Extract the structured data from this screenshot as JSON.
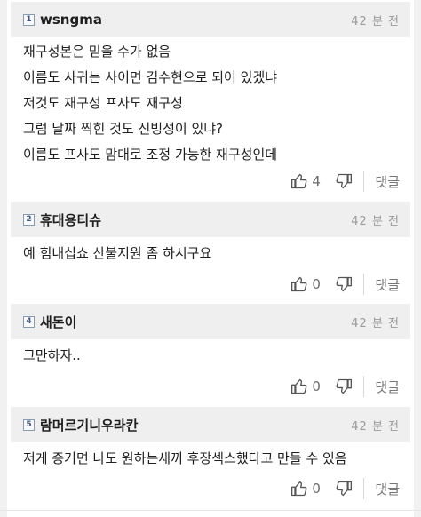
{
  "comments": [
    {
      "level": "1",
      "nickname": "wsngma",
      "time": "42 분 전",
      "lines": [
        "재구성본은 믿을 수가 없음",
        "이름도 사귀는 사이면 김수현으로 되어 있겠냐",
        "저것도 재구성 프사도 재구성",
        "그럼 날짜 찍힌 것도 신빙성이 있냐?",
        "이름도 프사도 맘대로 조정 가능한 재구성인데"
      ],
      "likes": "4",
      "reply_label": "댓글"
    },
    {
      "level": "2",
      "nickname": "휴대용티슈",
      "time": "42 분 전",
      "lines": [
        "예 힘내십쇼 산불지원 좀 하시구요"
      ],
      "likes": "0",
      "reply_label": "댓글"
    },
    {
      "level": "4",
      "nickname": "새돈이",
      "time": "42 분 전",
      "lines": [
        "그만하자.."
      ],
      "likes": "0",
      "reply_label": "댓글"
    },
    {
      "level": "5",
      "nickname": "람머르기니우라칸",
      "time": "42 분 전",
      "lines": [
        "저게 증거면 나도 원하는새끼 후장섹스했다고 만들 수 있음"
      ],
      "likes": "0",
      "reply_label": "댓글"
    }
  ],
  "colors": {
    "header_bg": "#efefef",
    "text": "#1e1e1e",
    "muted": "#9a9a9a"
  },
  "icons": {
    "like": "thumbs-up-icon",
    "dislike": "thumbs-down-icon"
  }
}
